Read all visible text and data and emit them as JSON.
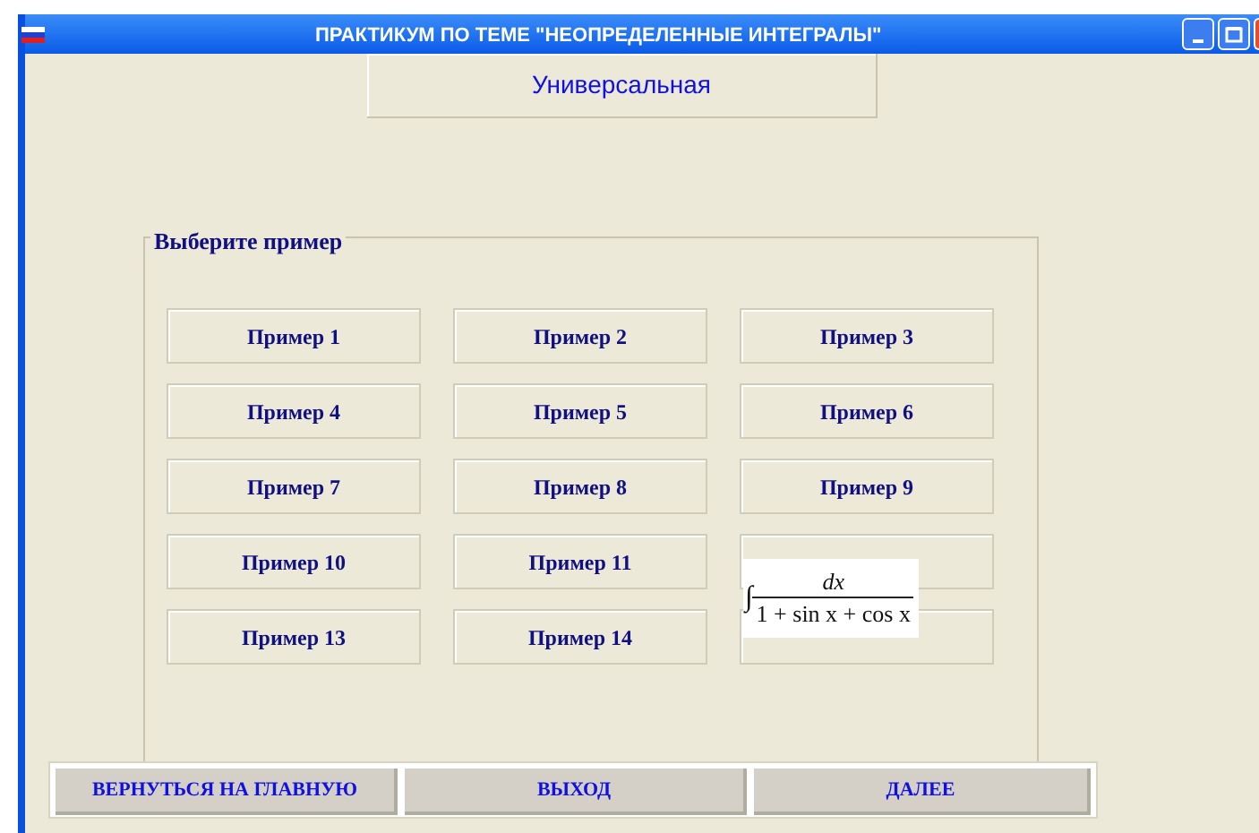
{
  "window": {
    "title": "ПРАКТИКУМ ПО ТЕМЕ \"НЕОПРЕДЕЛЕННЫЕ ИНТЕГРАЛЫ\""
  },
  "method_label": "Универсальная",
  "group": {
    "title": "Выберите пример",
    "buttons": [
      {
        "kind": "labeled",
        "label": "Пример 1"
      },
      {
        "kind": "labeled",
        "label": "Пример 2"
      },
      {
        "kind": "labeled",
        "label": "Пример 3"
      },
      {
        "kind": "labeled",
        "label": "Пример 4"
      },
      {
        "kind": "labeled",
        "label": "Пример 5"
      },
      {
        "kind": "labeled",
        "label": "Пример 6"
      },
      {
        "kind": "labeled",
        "label": "Пример 7"
      },
      {
        "kind": "labeled",
        "label": "Пример 8"
      },
      {
        "kind": "labeled",
        "label": "Пример 9"
      },
      {
        "kind": "labeled",
        "label": "Пример 10"
      },
      {
        "kind": "labeled",
        "label": "Пример 11"
      },
      {
        "kind": "covered"
      },
      {
        "kind": "labeled",
        "label": "Пример 13"
      },
      {
        "kind": "labeled",
        "label": "Пример 14"
      },
      {
        "kind": "covered"
      }
    ]
  },
  "tooltip": {
    "integral": "∫",
    "numerator": "dx",
    "denominator": "1 + sin x + cos x"
  },
  "bottom_buttons": [
    "ВЕРНУТЬСЯ НА ГЛАВНУЮ",
    "ВЫХОД",
    "ДАЛЕЕ"
  ]
}
